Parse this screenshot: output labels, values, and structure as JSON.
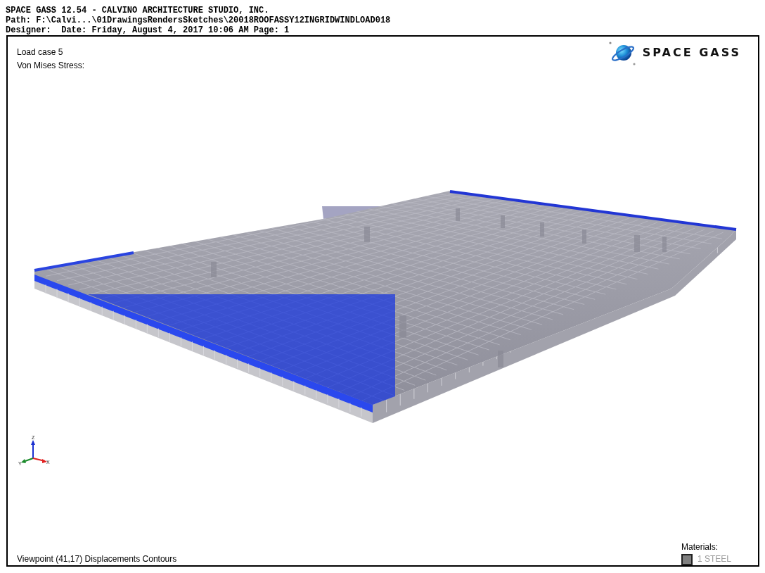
{
  "header": {
    "title": "SPACE GASS 12.54 - CALVINO ARCHITECTURE STUDIO, INC.",
    "path": "Path: F:\\Calvi...\\01DrawingsRendersSketches\\20018ROOFASSY12INGRIDWINDLOAD018",
    "details": "Designer:  Date: Friday, August 4, 2017 10:06 AM Page: 1"
  },
  "view": {
    "load_case": "Load case 5",
    "result": "Von Mises Stress:",
    "logo": "SPACE GASS",
    "axes": [
      {
        "kind": "z",
        "label": "Z"
      },
      {
        "kind": "y",
        "label": "Y"
      },
      {
        "kind": "x",
        "label": "X"
      }
    ],
    "viewpoint": "Viewpoint (41,17) Displacements Contours"
  },
  "materials": {
    "title": "Materials:",
    "items": [
      {
        "label": "1 STEEL",
        "color": "#808080"
      }
    ]
  }
}
